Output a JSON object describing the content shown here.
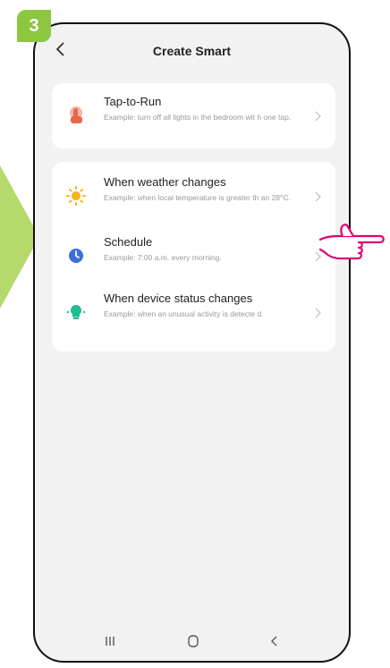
{
  "step": {
    "number": "3"
  },
  "header": {
    "title": "Create Smart",
    "back_icon": "chevron-left-icon"
  },
  "cards": [
    {
      "items": [
        {
          "name": "Tap-to-Run",
          "desc": "Example: turn off all lights in the bedroom wit h one tap.",
          "icon": "tap-finger-icon",
          "color": "#e8684a"
        }
      ]
    },
    {
      "items": [
        {
          "name": "When weather changes",
          "desc": "Example: when local temperature is greater th an 28°C.",
          "icon": "sun-icon",
          "color": "#f7b21e"
        },
        {
          "name": "Schedule",
          "desc": "Example: 7:00 a.m. every morning.",
          "icon": "clock-icon",
          "color": "#3b6fd8"
        },
        {
          "name": "When device status changes",
          "desc": "Example: when an unusual activity is detecte d.",
          "icon": "device-bulb-icon",
          "color": "#1fbf8f"
        }
      ]
    }
  ],
  "navbar": {
    "recent_icon": "recent-apps-icon",
    "home_icon": "home-icon",
    "back_icon": "back-icon"
  },
  "colors": {
    "accent_green": "#8dc63f",
    "hand": "#e0007a",
    "background": "#f2f2f2"
  }
}
